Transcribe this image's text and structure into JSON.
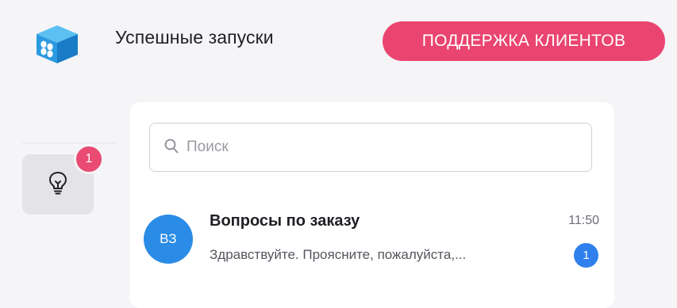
{
  "header": {
    "app_title": "Успешные запуски",
    "support_button": "ПОДДЕРЖКА КЛИЕНТОВ",
    "logo_icon": "blue-cube-logo-icon"
  },
  "sidebar": {
    "ideas_icon": "lightbulb-icon",
    "ideas_badge": "1"
  },
  "search": {
    "placeholder": "Поиск",
    "value": "",
    "icon": "search-icon"
  },
  "conversations": [
    {
      "avatar_initials": "ВЗ",
      "title": "Вопросы по заказу",
      "time": "11:50",
      "preview": "Здравствуйте. Проясните, пожалуйста,...",
      "unread_count": "1"
    }
  ],
  "colors": {
    "accent_pink": "#ea4470",
    "avatar_blue": "#2a8ce6",
    "unread_blue": "#2f80ed",
    "background": "#f5f5f7"
  }
}
